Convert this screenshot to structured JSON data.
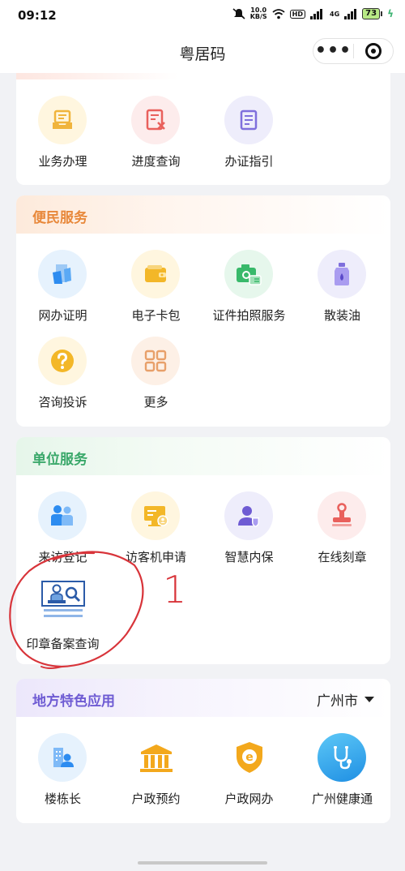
{
  "status_bar": {
    "time": "09:12",
    "speed_value": "10.0",
    "speed_unit": "KB/S",
    "hd": "HD",
    "net_4g": "4G",
    "battery": "73"
  },
  "nav": {
    "title": "粤居码",
    "more_glyph": "•••"
  },
  "top_section": {
    "items": [
      {
        "label": "业务办理",
        "icon": "business-tray-icon"
      },
      {
        "label": "进度查询",
        "icon": "progress-doc-icon"
      },
      {
        "label": "办证指引",
        "icon": "guide-doc-icon"
      }
    ]
  },
  "convenience": {
    "title": "便民服务",
    "items": [
      {
        "label": "网办证明",
        "icon": "online-certificate-icon"
      },
      {
        "label": "电子卡包",
        "icon": "wallet-icon"
      },
      {
        "label": "证件拍照服务",
        "icon": "camera-id-icon"
      },
      {
        "label": "散装油",
        "icon": "fuel-bottle-icon"
      },
      {
        "label": "咨询投诉",
        "icon": "question-icon"
      },
      {
        "label": "更多",
        "icon": "grid-more-icon"
      }
    ]
  },
  "unit_service": {
    "title": "单位服务",
    "items": [
      {
        "label": "来访登记",
        "icon": "visitors-icon"
      },
      {
        "label": "访客机申请",
        "icon": "visitor-machine-icon"
      },
      {
        "label": "智慧内保",
        "icon": "security-person-icon"
      },
      {
        "label": "在线刻章",
        "icon": "seal-stamp-icon"
      },
      {
        "label": "印章备案查询",
        "icon": "seal-record-search-icon"
      }
    ]
  },
  "local_apps": {
    "title": "地方特色应用",
    "city": "广州市",
    "items": [
      {
        "label": "楼栋长",
        "icon": "building-manager-icon"
      },
      {
        "label": "户政预约",
        "icon": "government-building-icon"
      },
      {
        "label": "户政网办",
        "icon": "e-shield-icon"
      },
      {
        "label": "广州健康通",
        "icon": "health-stethoscope-icon"
      }
    ]
  },
  "annotation": {
    "number": "1"
  },
  "colors": {
    "orange_title": "#e8883a",
    "green_title": "#3aa86a",
    "purple_title": "#6e5bd3",
    "annotation_red": "#d8343a"
  }
}
